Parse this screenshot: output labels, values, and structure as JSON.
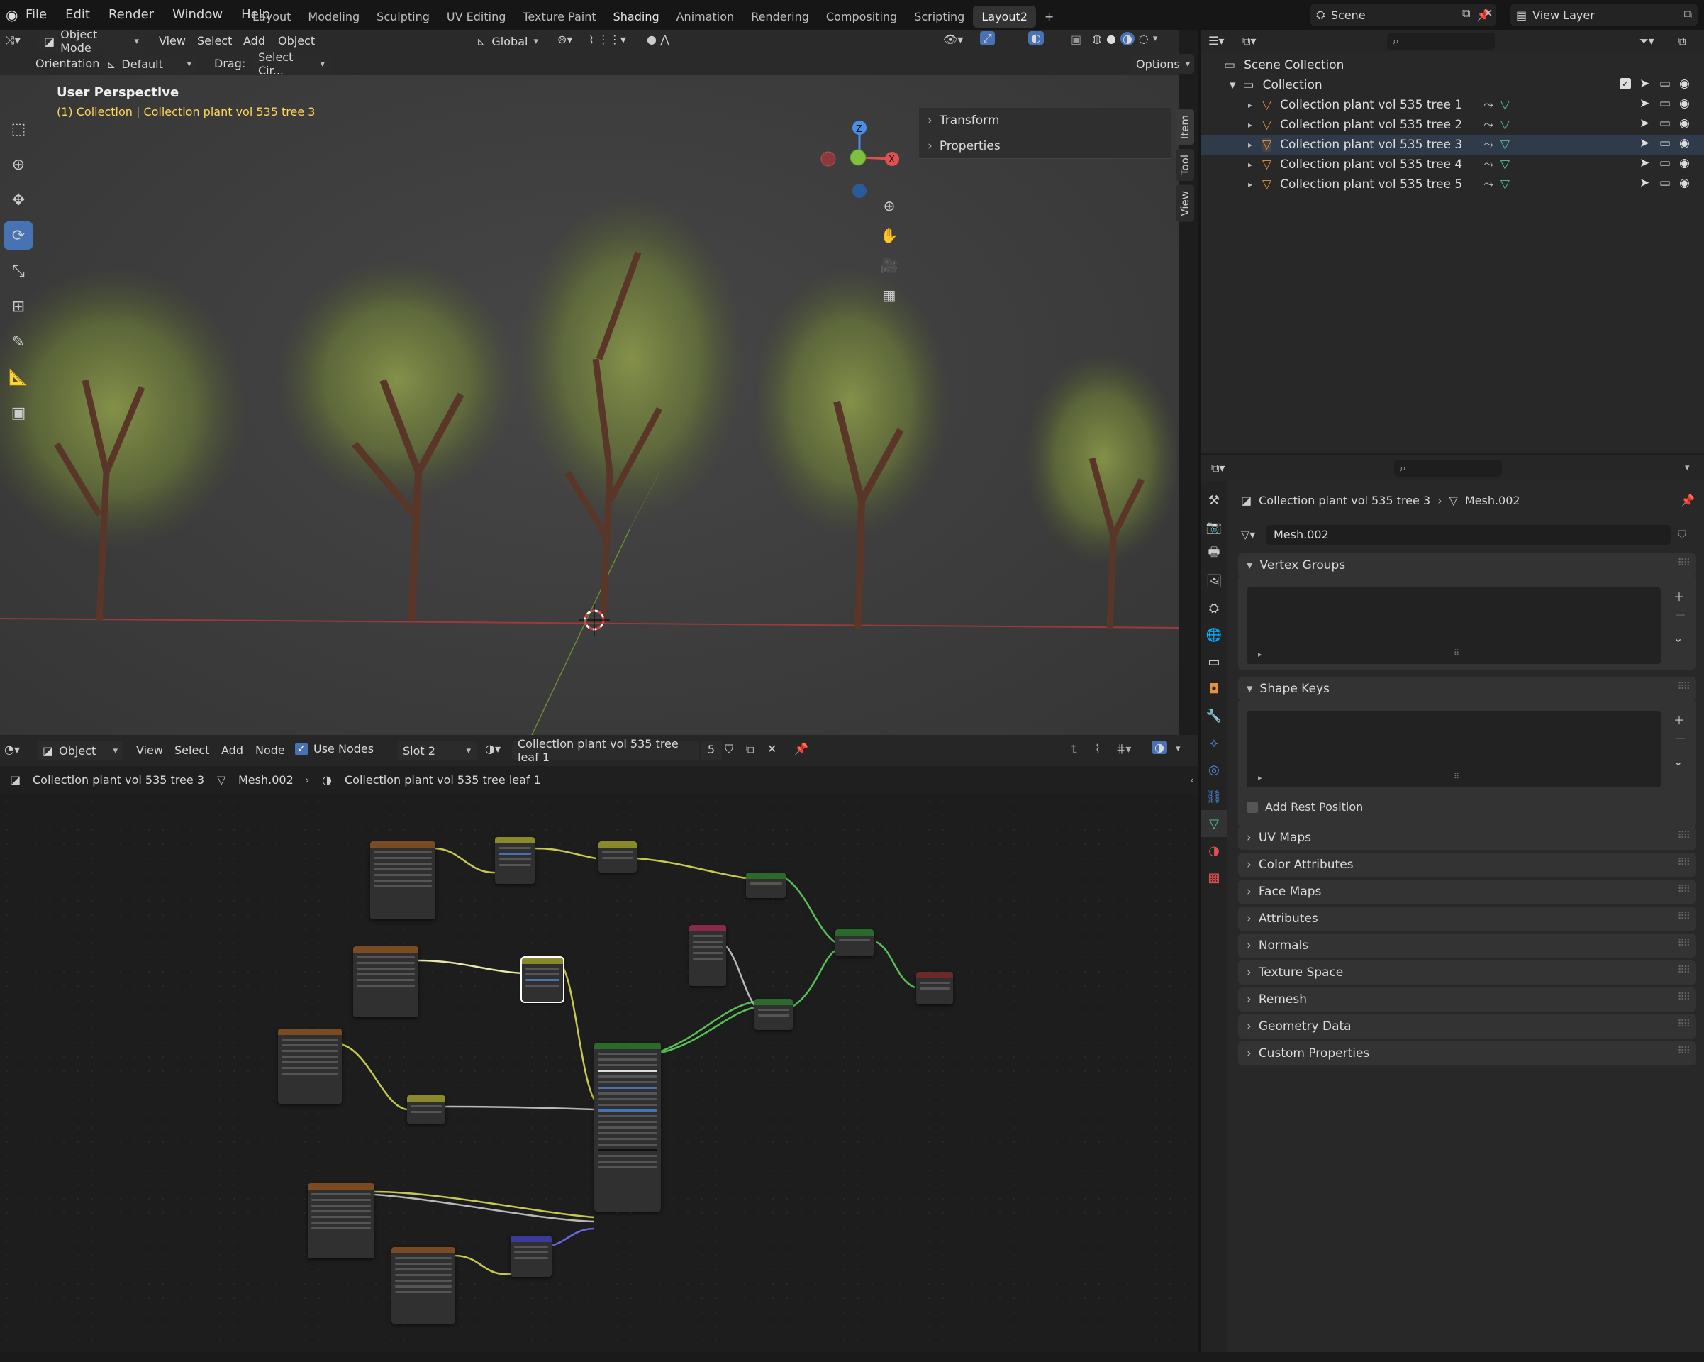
{
  "topbar": {
    "menus": [
      "File",
      "Edit",
      "Render",
      "Window",
      "Help"
    ],
    "workspaces": [
      "Layout",
      "Modeling",
      "Sculpting",
      "UV Editing",
      "Texture Paint",
      "Shading",
      "Animation",
      "Rendering",
      "Compositing",
      "Scripting",
      "Layout2"
    ],
    "active_workspace": "Layout2",
    "add_tab": "+",
    "scene_label": "Scene",
    "view_layer_label": "View Layer"
  },
  "viewport": {
    "mode": "Object Mode",
    "menus": [
      "View",
      "Select",
      "Add",
      "Object"
    ],
    "transform_space": "Global",
    "orientation_label": "Orientation:",
    "orientation_value": "Default",
    "drag_label": "Drag:",
    "drag_value": "Select Cir...",
    "options_label": "Options",
    "perspective": "User Perspective",
    "active_info": "(1) Collection | Collection plant vol 535 tree 3",
    "npanel_items": [
      "Transform",
      "Properties"
    ],
    "side_tabs": [
      "Item",
      "Tool",
      "View"
    ],
    "gizmo": {
      "x": "X",
      "y": "Y",
      "z": "Z"
    }
  },
  "node_editor": {
    "type": "Object",
    "menus": [
      "View",
      "Select",
      "Add",
      "Node"
    ],
    "use_nodes_label": "Use Nodes",
    "use_nodes_checked": true,
    "slot": "Slot 2",
    "material": "Collection plant vol 535 tree leaf 1",
    "user_count": "5",
    "breadcrumb": [
      "Collection plant vol 535 tree 3",
      "Mesh.002",
      "Collection plant vol 535 tree leaf 1"
    ]
  },
  "outliner": {
    "root": "Scene Collection",
    "collection": "Collection",
    "objects": [
      "Collection plant vol 535 tree 1",
      "Collection plant vol 535 tree 2",
      "Collection plant vol 535 tree 3",
      "Collection plant vol 535 tree 4",
      "Collection plant vol 535 tree 5"
    ],
    "selected_index": 2
  },
  "properties": {
    "object_name": "Collection plant vol 535 tree 3",
    "mesh_name": "Mesh.002",
    "datablock": "Mesh.002",
    "open_panels": [
      "Vertex Groups",
      "Shape Keys"
    ],
    "add_rest_position": "Add Rest Position",
    "closed_panels": [
      "UV Maps",
      "Color Attributes",
      "Face Maps",
      "Attributes",
      "Normals",
      "Texture Space",
      "Remesh",
      "Geometry Data",
      "Custom Properties"
    ]
  },
  "colors": {
    "accent": "#4772b3",
    "selection_text": "#ffd65a",
    "x_axis": "#e05050",
    "y_axis": "#80c040",
    "z_axis": "#4a8ee8",
    "mesh_data": "#4fc29a",
    "object_orange": "#e8913a"
  }
}
